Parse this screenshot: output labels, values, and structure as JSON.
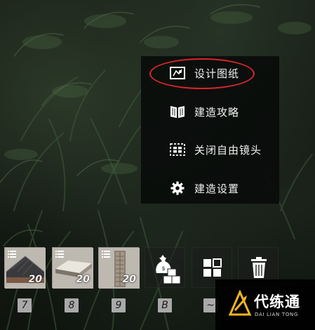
{
  "menu": {
    "items": [
      {
        "label": "设计图纸",
        "icon": "blueprint-icon"
      },
      {
        "label": "建造攻略",
        "icon": "book-icon"
      },
      {
        "label": "关闭自由镜头",
        "icon": "free-camera-icon"
      },
      {
        "label": "建造设置",
        "icon": "gear-icon"
      }
    ]
  },
  "hotbar": {
    "slots": [
      {
        "key": "7",
        "count": "20",
        "icon": "roof-piece-icon"
      },
      {
        "key": "8",
        "count": "20",
        "icon": "floor-slab-icon"
      },
      {
        "key": "9",
        "count": "20",
        "icon": "wall-piece-icon"
      },
      {
        "key": "B",
        "icon": "bag-and-boxes-icon"
      },
      {
        "key": "~",
        "icon": "grid-icon"
      },
      {
        "icon": "trash-icon"
      }
    ]
  },
  "watermark": {
    "text": "代练通",
    "subtext": "DAI LIAN TONG"
  },
  "colors": {
    "highlight": "#d8262b",
    "menu_bg": "#080a09"
  }
}
